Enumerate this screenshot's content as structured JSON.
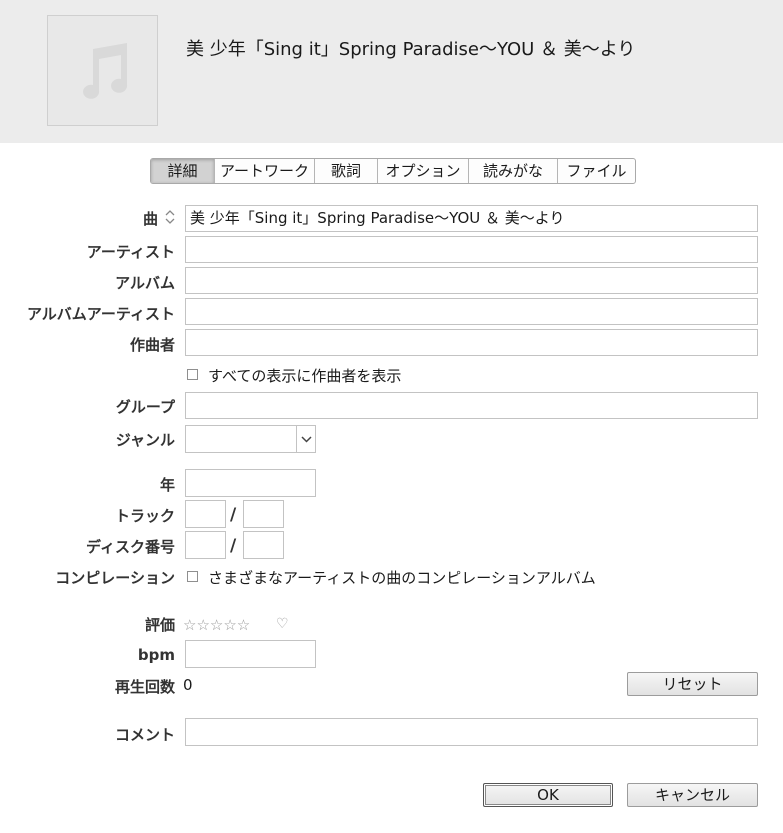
{
  "song": {
    "title": "美 少年「Sing it」Spring Paradise～YOU ＆ 美～より"
  },
  "artwork": {
    "icon": "music-note-icon"
  },
  "tabs": [
    {
      "label": "詳細",
      "active": true
    },
    {
      "label": "アートワーク",
      "active": false
    },
    {
      "label": "歌詞",
      "active": false
    },
    {
      "label": "オプション",
      "active": false
    },
    {
      "label": "読みがな",
      "active": false
    },
    {
      "label": "ファイル",
      "active": false
    }
  ],
  "labels": {
    "song": "曲",
    "artist": "アーティスト",
    "album": "アルバム",
    "album_artist": "アルバムアーティスト",
    "composer": "作曲者",
    "grouping": "グループ",
    "genre": "ジャンル",
    "year": "年",
    "track": "トラック",
    "disc": "ディスク番号",
    "compilation": "コンピレーション",
    "rating": "評価",
    "bpm": "bpm",
    "play_count": "再生回数",
    "comment": "コメント"
  },
  "fields": {
    "song": "美 少年「Sing it」Spring Paradise～YOU ＆ 美～より",
    "artist": "",
    "album": "",
    "album_artist": "",
    "composer": "",
    "grouping": "",
    "genre": "",
    "year": "",
    "track_number": "",
    "track_count": "",
    "disc_number": "",
    "disc_count": "",
    "bpm": "",
    "comment": ""
  },
  "checkboxes": {
    "show_composer": {
      "label": "すべての表示に作曲者を表示",
      "checked": false
    },
    "compilation": {
      "label": "さまざまなアーティストの曲のコンピレーションアルバム",
      "checked": false
    }
  },
  "track_sep": "/",
  "rating": {
    "stars": "☆☆☆☆☆",
    "value": 0,
    "max": 5,
    "heart": "♡"
  },
  "play_count": "0",
  "buttons": {
    "reset": "リセット",
    "ok": "OK",
    "cancel": "キャンセル"
  },
  "colors": {
    "header_bg": "#ececec",
    "active_tab_bg": "#d2d2d2"
  }
}
